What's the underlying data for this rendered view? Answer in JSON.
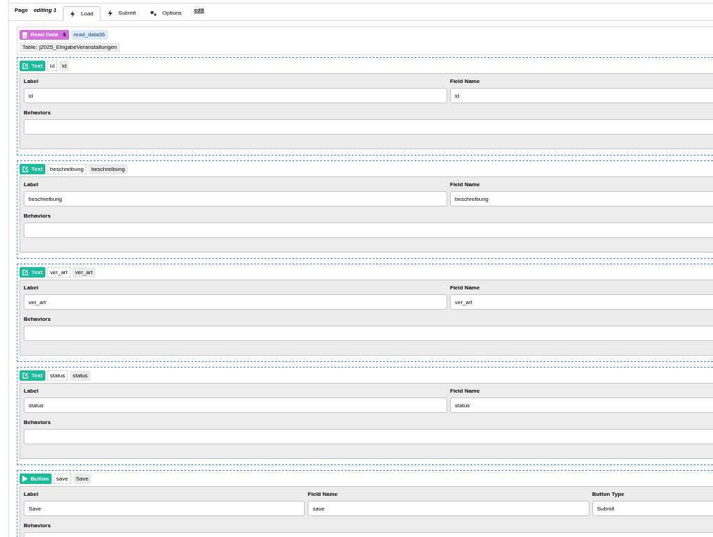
{
  "tabs_bar": {
    "page_label": "Page",
    "page_state": "editing 1",
    "tabs": [
      {
        "label": "Load",
        "kind": "action",
        "selected": true
      },
      {
        "label": "Submit",
        "kind": "action",
        "selected": false
      },
      {
        "label": "Options",
        "kind": "settings",
        "selected": false
      }
    ],
    "edit_link": "edit"
  },
  "data_source": {
    "badge": "Read Data",
    "badge_suffix": "$",
    "name": "read_data36",
    "table_label": "Table:",
    "table_name": "j2025_EingabeVeranstaltungen"
  },
  "components": [
    {
      "kind": "text",
      "type_label": "Text",
      "name": "id",
      "label_tag": "id",
      "fields": [
        {
          "label": "Label",
          "value": "id"
        },
        {
          "label": "Field Name",
          "value": "id"
        }
      ],
      "behaviors_label": "Behaviors"
    },
    {
      "kind": "text",
      "type_label": "Text",
      "name": "beschreibung",
      "label_tag": "beschreibung",
      "fields": [
        {
          "label": "Label",
          "value": "beschreibung"
        },
        {
          "label": "Field Name",
          "value": "beschreibung"
        }
      ],
      "behaviors_label": "Behaviors"
    },
    {
      "kind": "text",
      "type_label": "Text",
      "name": "ver_art",
      "label_tag": "ver_art",
      "fields": [
        {
          "label": "Label",
          "value": "ver_art"
        },
        {
          "label": "Field Name",
          "value": "ver_art"
        }
      ],
      "behaviors_label": "Behaviors"
    },
    {
      "kind": "text",
      "type_label": "Text",
      "name": "status",
      "label_tag": "status",
      "fields": [
        {
          "label": "Label",
          "value": "status"
        },
        {
          "label": "Field Name",
          "value": "status"
        }
      ],
      "behaviors_label": "Behaviors"
    },
    {
      "kind": "button",
      "type_label": "Button",
      "name": "save",
      "label_tag": "Save",
      "fields": [
        {
          "label": "Label",
          "value": "Save"
        },
        {
          "label": "Field Name",
          "value": "save"
        },
        {
          "label": "Button Type",
          "value": "Submit"
        }
      ],
      "behaviors_label": "Behaviors"
    }
  ]
}
